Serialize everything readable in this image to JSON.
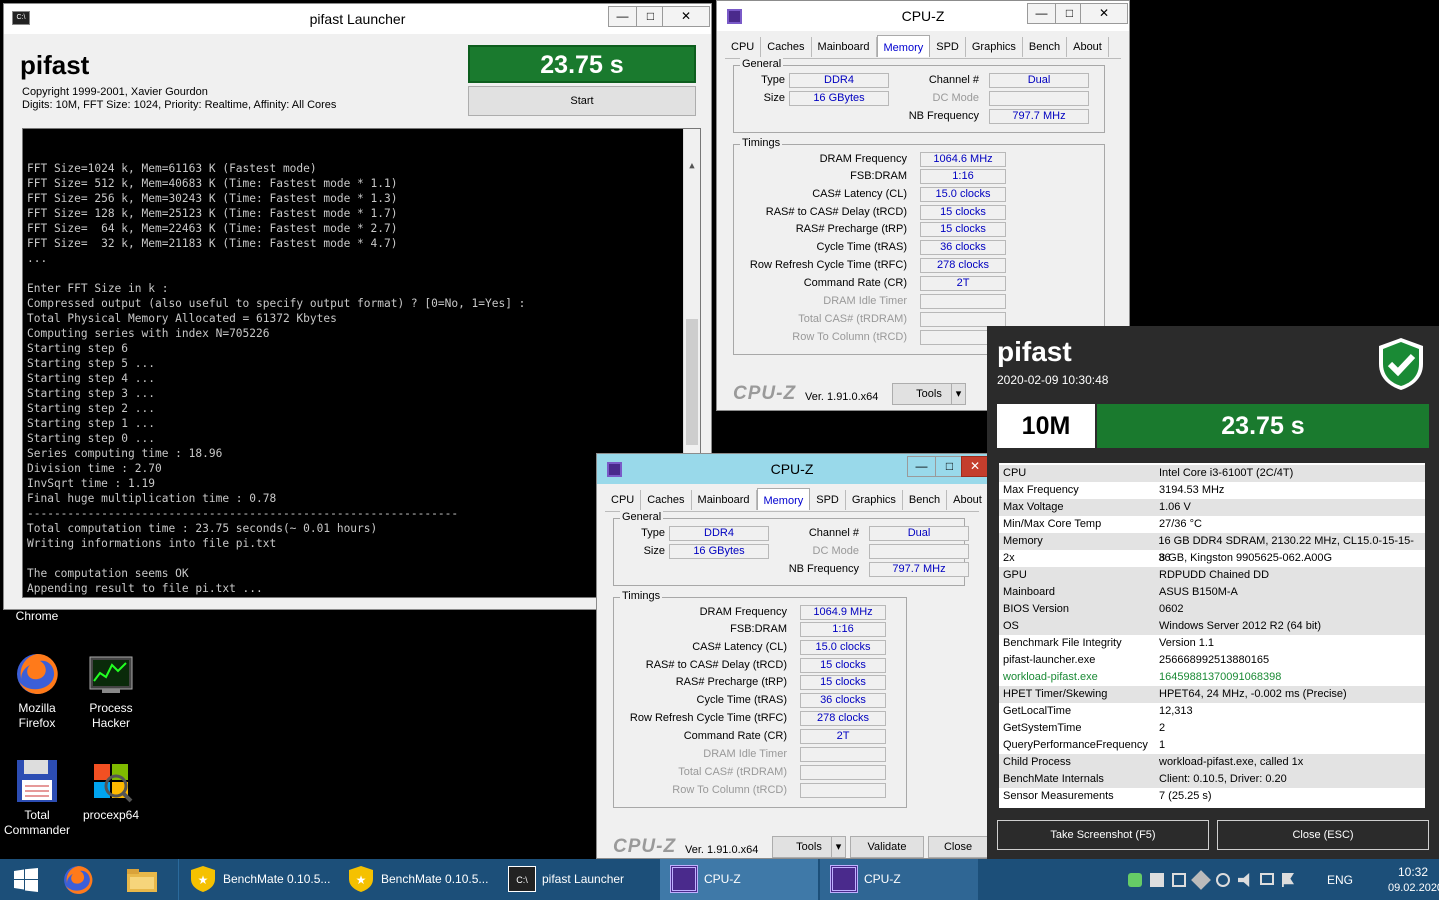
{
  "desktop": {
    "icons": [
      {
        "label": "Chrome"
      },
      {
        "label": "Mozilla Firefox"
      },
      {
        "label": "Process Hacker"
      },
      {
        "label": "Total Commander"
      },
      {
        "label": "procexp64"
      }
    ]
  },
  "launcher": {
    "title": "pifast Launcher",
    "app_name": "pifast",
    "copyright": "Copyright 1999-2001, Xavier Gourdon",
    "settings": "Digits: 10M, FFT Size: 1024, Priority: Realtime, Affinity: All Cores",
    "result": "23.75 s",
    "start_label": "Start",
    "console_lines": [
      "FFT Size=1024 k, Mem=61163 K (Fastest mode)",
      "FFT Size= 512 k, Mem=40683 K (Time: Fastest mode * 1.1)",
      "FFT Size= 256 k, Mem=30243 K (Time: Fastest mode * 1.3)",
      "FFT Size= 128 k, Mem=25123 K (Time: Fastest mode * 1.7)",
      "FFT Size=  64 k, Mem=22463 K (Time: Fastest mode * 2.7)",
      "FFT Size=  32 k, Mem=21183 K (Time: Fastest mode * 4.7)",
      "...",
      "",
      "Enter FFT Size in k :",
      "Compressed output (also useful to specify output format) ? [0=No, 1=Yes] :",
      "Total Physical Memory Allocated = 61372 Kbytes",
      "Computing series with index N=705226",
      "Starting step 6",
      "Starting step 5 ...",
      "Starting step 4 ...",
      "Starting step 3 ...",
      "Starting step 2 ...",
      "Starting step 1 ...",
      "Starting step 0 ...",
      "Series computing time : 18.96",
      "Division time : 2.70",
      "InvSqrt time : 1.19",
      "Final huge multiplication time : 0.78",
      "----------------------------------------------------------------",
      "Total computation time : 23.75 seconds(~ 0.01 hours)",
      "Writing informations into file pi.txt",
      "",
      "The computation seems OK",
      "Appending result to file pi.txt ..."
    ]
  },
  "cpuz": {
    "title": "CPU-Z",
    "tabs": [
      "CPU",
      "Caches",
      "Mainboard",
      "Memory",
      "SPD",
      "Graphics",
      "Bench",
      "About"
    ],
    "active_tab": "Memory",
    "general_label": "General",
    "timings_label": "Timings",
    "labels": {
      "type": "Type",
      "size": "Size",
      "channel": "Channel #",
      "dc_mode": "DC Mode",
      "nb_freq": "NB Frequency",
      "dram_freq": "DRAM Frequency",
      "fsb_dram": "FSB:DRAM",
      "cl": "CAS# Latency (CL)",
      "trcd": "RAS# to CAS# Delay (tRCD)",
      "trp": "RAS# Precharge (tRP)",
      "tras": "Cycle Time (tRAS)",
      "trfc": "Row Refresh Cycle Time (tRFC)",
      "cr": "Command Rate (CR)",
      "idle": "DRAM Idle Timer",
      "trdram": "Total CAS# (tRDRAM)",
      "rtc": "Row To Column (tRCD)"
    },
    "values": {
      "type": "DDR4",
      "size": "16 GBytes",
      "channel": "Dual",
      "nb_freq": "797.7 MHz",
      "fsb_dram": "1:16",
      "cl": "15.0 clocks",
      "trcd": "15 clocks",
      "trp": "15 clocks",
      "tras": "36 clocks",
      "trfc": "278 clocks",
      "cr": "2T"
    },
    "dram_freq_1": "1064.6 MHz",
    "dram_freq_2": "1064.9 MHz",
    "logo": "CPU-Z",
    "version": "Ver. 1.91.0.x64",
    "tools_label": "Tools",
    "validate_label": "Validate",
    "close_label": "Close"
  },
  "benchmate": {
    "title": "pifast",
    "datetime": "2020-02-09 10:30:48",
    "digits": "10M",
    "result": "23.75 s",
    "rows": [
      {
        "k": "CPU",
        "v": "Intel Core i3-6100T (2C/4T)"
      },
      {
        "k": "Max Frequency",
        "v": "3194.53 MHz"
      },
      {
        "k": "Max Voltage",
        "v": "1.06 V"
      },
      {
        "k": "Min/Max Core Temp",
        "v": "27/36 °C"
      },
      {
        "k": "Memory",
        "v": "16 GB DDR4 SDRAM, 2130.22 MHz, CL15.0-15-15-36"
      },
      {
        "k": "2x",
        "v": "8 GB, Kingston 9905625-062.A00G"
      },
      {
        "k": "GPU",
        "v": "RDPUDD Chained DD"
      },
      {
        "k": "Mainboard",
        "v": "ASUS B150M-A"
      },
      {
        "k": "BIOS Version",
        "v": "0602"
      },
      {
        "k": "OS",
        "v": "Windows Server 2012 R2 (64 bit)"
      },
      {
        "k": "Benchmark File Integrity",
        "v": "Version 1.1"
      },
      {
        "k": "pifast-launcher.exe",
        "v": "256668992513880165"
      },
      {
        "k": "workload-pifast.exe",
        "v": "164598813700910683​98",
        "green": true
      },
      {
        "k": "HPET Timer/Skewing",
        "v": "HPET64, 24 MHz, -0.002 ms (Precise)"
      },
      {
        "k": "GetLocalTime",
        "v": "12,313"
      },
      {
        "k": "GetSystemTime",
        "v": "2"
      },
      {
        "k": "QueryPerformanceFrequency",
        "v": "1"
      },
      {
        "k": "Child Process",
        "v": "workload-pifast.exe, called 1x"
      },
      {
        "k": "BenchMate Internals",
        "v": "Client: 0.10.5, Driver: 0.20"
      },
      {
        "k": "Sensor Measurements",
        "v": "7 (25.25 s)"
      }
    ],
    "screenshot_label": "Take Screenshot (F5)",
    "close_label": "Close (ESC)"
  },
  "taskbar": {
    "items": [
      {
        "label": "BenchMate 0.10.5..."
      },
      {
        "label": "BenchMate 0.10.5..."
      },
      {
        "label": "pifast Launcher"
      },
      {
        "label": "CPU-Z"
      },
      {
        "label": "CPU-Z"
      }
    ],
    "lang": "ENG",
    "time": "10:32",
    "date": "09.02.2020"
  },
  "colors": {
    "accent_green": "#1a7a2e",
    "cpuz_active_title": "#99d9ea",
    "taskbar": "#1c4f79"
  }
}
